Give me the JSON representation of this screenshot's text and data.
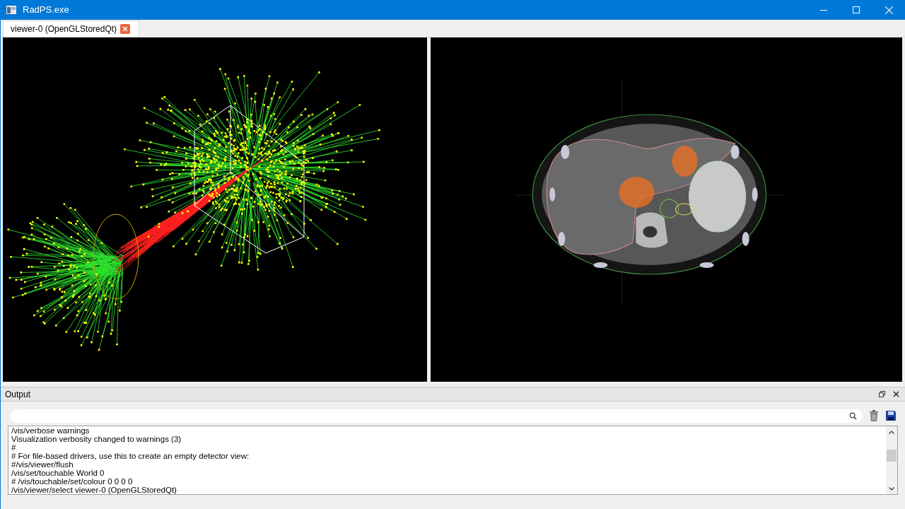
{
  "window": {
    "title": "RadPS.exe"
  },
  "tabs": [
    {
      "label": "viewer-0 (OpenGLStoredQt)",
      "selected": true
    }
  ],
  "viewers": [
    {
      "kind": "tracks"
    },
    {
      "kind": "ct"
    }
  ],
  "output": {
    "title": "Output",
    "lines": [
      "/vis/verbose warnings",
      "Visualization verbosity changed to warnings (3)",
      "#",
      "# For file-based drivers, use this to create an empty detector view:",
      "#/vis/viewer/flush",
      "/vis/set/touchable World 0",
      "# /vis/touchable/set/colour 0 0 0 0",
      "/vis/viewer/select viewer-0 (OpenGLStoredQt)"
    ]
  }
}
